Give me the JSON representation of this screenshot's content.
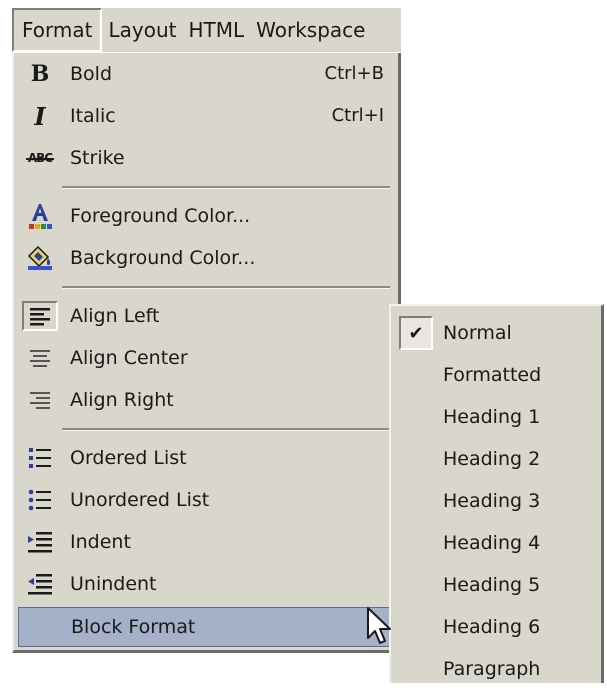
{
  "menubar": {
    "items": [
      "Format",
      "Layout",
      "HTML",
      "Workspace"
    ]
  },
  "format_menu": {
    "bold": {
      "label": "Bold",
      "shortcut": "Ctrl+B",
      "icon": "bold-icon"
    },
    "italic": {
      "label": "Italic",
      "shortcut": "Ctrl+I",
      "icon": "italic-icon"
    },
    "strike": {
      "label": "Strike",
      "icon": "strike-icon"
    },
    "foreground": {
      "label": "Foreground Color...",
      "icon": "foreground-color-icon"
    },
    "background": {
      "label": "Background Color...",
      "icon": "background-color-icon"
    },
    "align_left": {
      "label": "Align Left",
      "icon": "align-left-icon"
    },
    "align_center": {
      "label": "Align Center",
      "icon": "align-center-icon"
    },
    "align_right": {
      "label": "Align Right",
      "icon": "align-right-icon"
    },
    "ordered_list": {
      "label": "Ordered List",
      "icon": "ordered-list-icon"
    },
    "unordered_list": {
      "label": "Unordered List",
      "icon": "unordered-list-icon"
    },
    "indent": {
      "label": "Indent",
      "icon": "indent-icon"
    },
    "unindent": {
      "label": "Unindent",
      "icon": "unindent-icon"
    },
    "block_format": {
      "label": "Block Format"
    }
  },
  "block_format_submenu": {
    "checked": "Normal",
    "items": [
      "Normal",
      "Formatted",
      "Heading 1",
      "Heading 2",
      "Heading 3",
      "Heading 4",
      "Heading 5",
      "Heading 6",
      "Paragraph"
    ]
  },
  "colors": {
    "menu_bg": "#d9d6cb",
    "highlight": "#a5b1c9",
    "text": "#1a1a1a"
  }
}
